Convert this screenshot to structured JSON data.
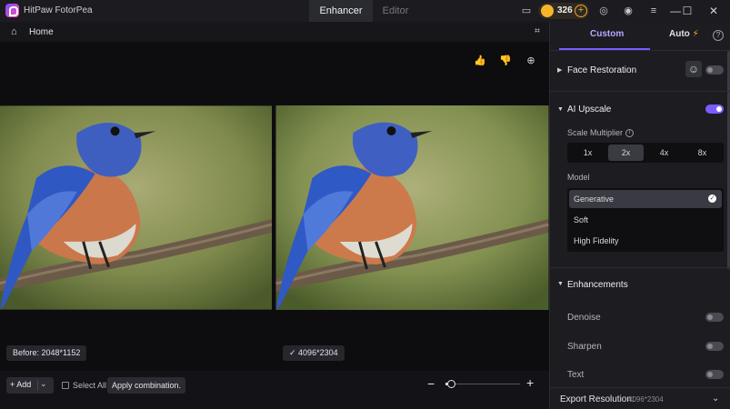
{
  "app": {
    "title": "HitPaw FotorPea"
  },
  "tabs": {
    "enhancer": "Enhancer",
    "editor": "Editor"
  },
  "credits": {
    "count": "326"
  },
  "titlebar_icons": [
    "window-icon",
    "coin-icon",
    "plus-icon",
    "discord-icon",
    "account-icon",
    "menu-icon",
    "minimize-icon",
    "maximize-icon",
    "close-icon"
  ],
  "toolbar": {
    "home_label": "Home"
  },
  "canvas": {
    "before_label": "Before: 2048*1152",
    "after_label": "4096*2304",
    "tools": [
      "thumbs-up-icon",
      "thumbs-down-icon",
      "zoom-in-icon"
    ]
  },
  "bottom": {
    "add_label": "Add",
    "select_all_label": "Select All",
    "apply_label": "Apply combination.",
    "zoom_level": 0.08
  },
  "panel": {
    "tab_custom": "Custom",
    "tab_auto": "Auto",
    "accent_color": "#7c5cff",
    "face_restoration": {
      "label": "Face Restoration",
      "enabled": false
    },
    "ai_upscale": {
      "label": "AI Upscale",
      "enabled": true,
      "scale_label": "Scale Multiplier",
      "scale_options": [
        "1x",
        "2x",
        "4x",
        "8x"
      ],
      "scale_selected": "2x",
      "model_label": "Model",
      "model_options": [
        "Generative",
        "Soft",
        "High Fidelity"
      ],
      "model_selected": "Generative"
    },
    "enhancements": {
      "label": "Enhancements",
      "items": [
        {
          "label": "Denoise",
          "enabled": false
        },
        {
          "label": "Sharpen",
          "enabled": false
        },
        {
          "label": "Text",
          "enabled": false
        }
      ]
    },
    "export": {
      "label": "Export Resolution:",
      "value": "4096*2304"
    }
  }
}
